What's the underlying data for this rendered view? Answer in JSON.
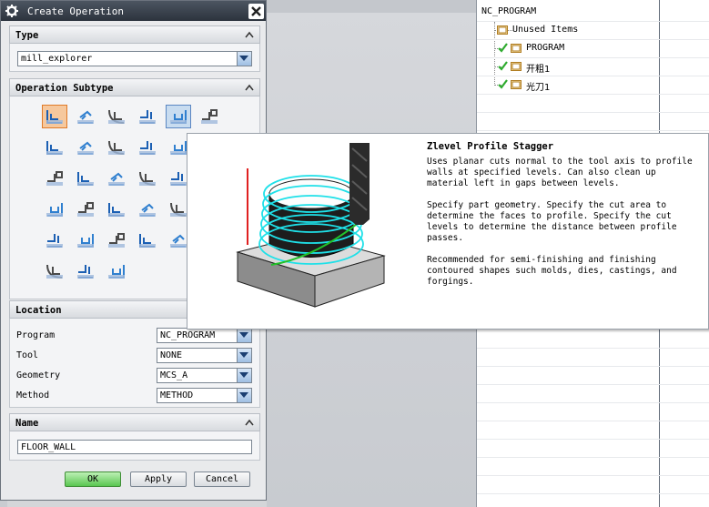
{
  "dialog": {
    "title": "Create Operation",
    "type_section": {
      "label": "Type",
      "value": "mill_explorer"
    },
    "subtype_section": {
      "label": "Operation Subtype",
      "icons": [
        "mill-1",
        "mill-2",
        "mill-3",
        "mill-4",
        "mill-5",
        "mill-6",
        "mill-7",
        "mill-8",
        "mill-9",
        "mill-10",
        "mill-11",
        "mill-12",
        "mill-13",
        "mill-14",
        "mill-15",
        "mill-16",
        "mill-17",
        "mill-18",
        "mill-19",
        "mill-20",
        "mill-21",
        "mill-22",
        "mill-23",
        "mill-24",
        "mill-25",
        "mill-26",
        "mill-27",
        "mill-28",
        "mill-29"
      ]
    },
    "location_section": {
      "label": "Location",
      "program_label": "Program",
      "program_value": "NC_PROGRAM",
      "tool_label": "Tool",
      "tool_value": "NONE",
      "geometry_label": "Geometry",
      "geometry_value": "MCS_A",
      "method_label": "Method",
      "method_value": "METHOD"
    },
    "name_section": {
      "label": "Name",
      "value": "FLOOR_WALL"
    },
    "buttons": {
      "ok": "OK",
      "apply": "Apply",
      "cancel": "Cancel"
    }
  },
  "tooltip": {
    "title": "Zlevel Profile Stagger",
    "para1": "Uses planar cuts normal to the tool axis to profile walls at specified levels. Can also clean up material left in gaps between levels.",
    "para2": "Specify part geometry. Specify the cut area to determine the faces to profile. Specify the cut levels to determine the distance between profile passes.",
    "para3": "Recommended for semi-finishing and finishing contoured shapes such molds, dies, castings, and forgings."
  },
  "navigator": {
    "root": "NC_PROGRAM",
    "items": [
      {
        "label": "Unused Items",
        "check": false
      },
      {
        "label": "PROGRAM",
        "check": true
      },
      {
        "label": "开粗1",
        "check": true
      },
      {
        "label": "光刀1",
        "check": true
      }
    ]
  },
  "colors": {
    "title_bar": "#2c333d",
    "ok_button": "#59c650",
    "selected_icon": "#f6c89d",
    "check": "#2eab2e",
    "toolpath": "#1fe0e8"
  }
}
